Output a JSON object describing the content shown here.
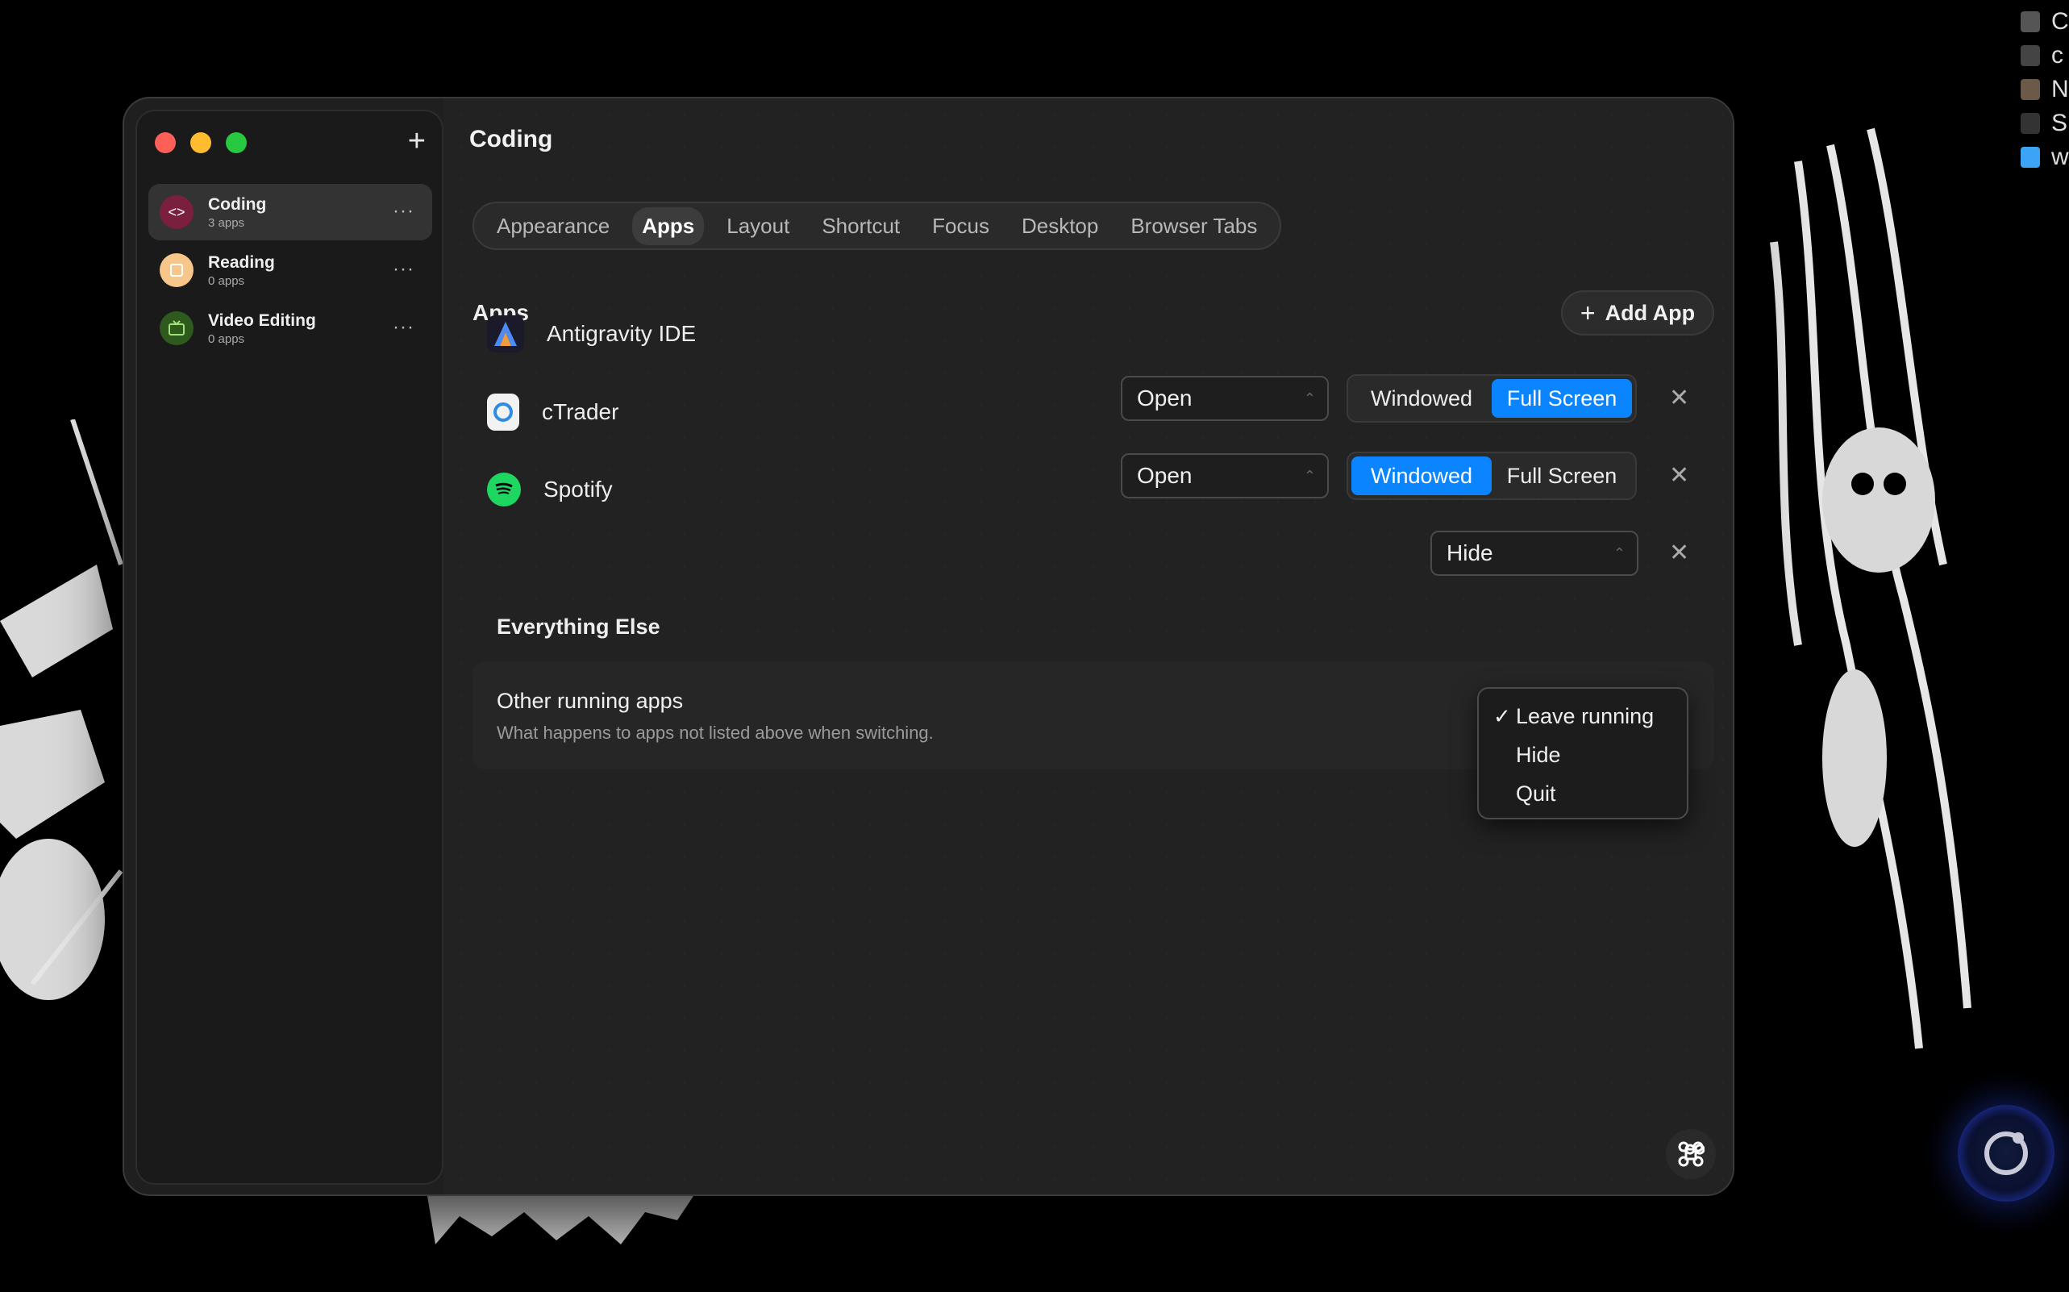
{
  "desktop": {
    "items": [
      {
        "label": "C",
        "color": "#555"
      },
      {
        "label": "c",
        "color": "#444"
      },
      {
        "label": "N",
        "color": "#6b5a48"
      },
      {
        "label": "S",
        "color": "#333"
      },
      {
        "label": "w",
        "color": "#3ba4f5"
      }
    ]
  },
  "window": {
    "title": "Coding",
    "sidebar": {
      "add_label": "+",
      "spaces": [
        {
          "name": "Coding",
          "count": "3 apps",
          "icon": "code-icon",
          "color": "#7a1f3d",
          "active": true
        },
        {
          "name": "Reading",
          "count": "0 apps",
          "icon": "book-icon",
          "color": "#f6c68a",
          "active": false
        },
        {
          "name": "Video Editing",
          "count": "0 apps",
          "icon": "tv-icon",
          "color": "#2f5a1e",
          "active": false
        }
      ],
      "more_label": "···"
    },
    "tabs": [
      "Appearance",
      "Apps",
      "Layout",
      "Shortcut",
      "Focus",
      "Desktop",
      "Browser Tabs"
    ],
    "active_tab": "Apps",
    "apps_section": {
      "heading": "Apps",
      "add_button": "Add App",
      "apps": [
        {
          "name": "Antigravity IDE",
          "action": "Open",
          "mode_options": [
            "Windowed",
            "Full Screen"
          ],
          "mode": "Full Screen",
          "icon": "antigravity-icon"
        },
        {
          "name": "cTrader",
          "action": "Open",
          "mode_options": [
            "Windowed",
            "Full Screen"
          ],
          "mode": "Windowed",
          "icon": "ctrader-icon"
        },
        {
          "name": "Spotify",
          "action": "Hide",
          "icon": "spotify-icon"
        }
      ],
      "remove_label": "✕"
    },
    "everything_else": {
      "heading": "Everything Else",
      "title": "Other running apps",
      "description": "What happens to apps not listed above when switching.",
      "menu_options": [
        "Leave running",
        "Hide",
        "Quit"
      ],
      "selected": "Leave running"
    }
  }
}
